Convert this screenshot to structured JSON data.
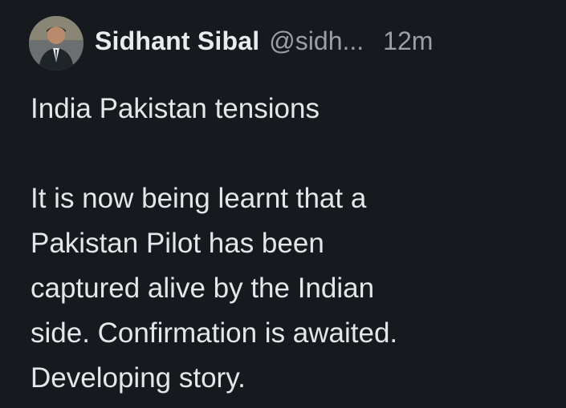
{
  "tweet": {
    "author_name": "Sidhant Sibal",
    "author_handle": "@sidh...",
    "timestamp": "12m",
    "avatar_icon": "profile-photo-man-in-suit",
    "lines": [
      "India Pakistan tensions",
      "",
      "It is now being learnt that a",
      "Pakistan Pilot has been",
      "captured alive by the Indian",
      "side. Confirmation is awaited.",
      "Developing story."
    ]
  },
  "colors": {
    "background": "#16191e",
    "text_primary": "#e4e6e9",
    "text_secondary": "#9aa0a6"
  }
}
